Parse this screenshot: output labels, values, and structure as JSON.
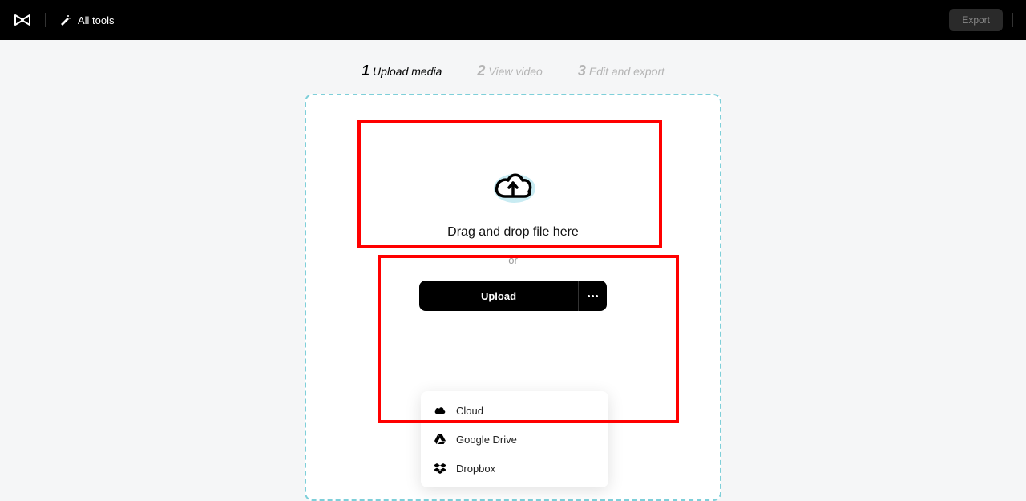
{
  "header": {
    "all_tools_label": "All tools",
    "export_label": "Export"
  },
  "steps": [
    {
      "num": "1",
      "label": "Upload media",
      "active": true
    },
    {
      "num": "2",
      "label": "View video",
      "active": false
    },
    {
      "num": "3",
      "label": "Edit and export",
      "active": false
    }
  ],
  "dropzone": {
    "drag_text": "Drag and drop file here",
    "or_text": "or",
    "upload_label": "Upload"
  },
  "upload_sources": [
    {
      "name": "Cloud",
      "icon": "cloud"
    },
    {
      "name": "Google Drive",
      "icon": "gdrive"
    },
    {
      "name": "Dropbox",
      "icon": "dropbox"
    }
  ]
}
